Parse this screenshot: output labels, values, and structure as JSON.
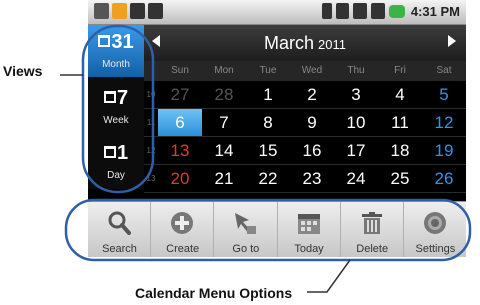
{
  "status_bar": {
    "time": "4:31 PM"
  },
  "views": {
    "items": [
      {
        "glyph": "31",
        "label": "Month",
        "active": true
      },
      {
        "glyph": "7",
        "label": "Week",
        "active": false
      },
      {
        "glyph": "1",
        "label": "Day",
        "active": false
      }
    ]
  },
  "month_header": {
    "month": "March",
    "year": "2011"
  },
  "day_names": [
    "Sun",
    "Mon",
    "Tue",
    "Wed",
    "Thu",
    "Fri",
    "Sat"
  ],
  "weeks": [
    {
      "week": "10",
      "days": [
        "27",
        "28",
        "1",
        "2",
        "3",
        "4",
        "5"
      ]
    },
    {
      "week": "11",
      "days": [
        "6",
        "7",
        "8",
        "9",
        "10",
        "11",
        "12"
      ]
    },
    {
      "week": "12",
      "days": [
        "13",
        "14",
        "15",
        "16",
        "17",
        "18",
        "19"
      ]
    },
    {
      "week": "13",
      "days": [
        "20",
        "21",
        "22",
        "23",
        "24",
        "25",
        "26"
      ]
    }
  ],
  "selected_day": "6",
  "menu": {
    "search": "Search",
    "create": "Create",
    "goto": "Go to",
    "today": "Today",
    "delete": "Delete",
    "settings": "Settings"
  },
  "callouts": {
    "views": "Views",
    "menu": "Calendar Menu Options"
  },
  "colors": {
    "accent": "#2d8fd8",
    "callout_outline": "#2f5fa8",
    "sunday": "#e03b2c",
    "saturday": "#2f95e8"
  }
}
